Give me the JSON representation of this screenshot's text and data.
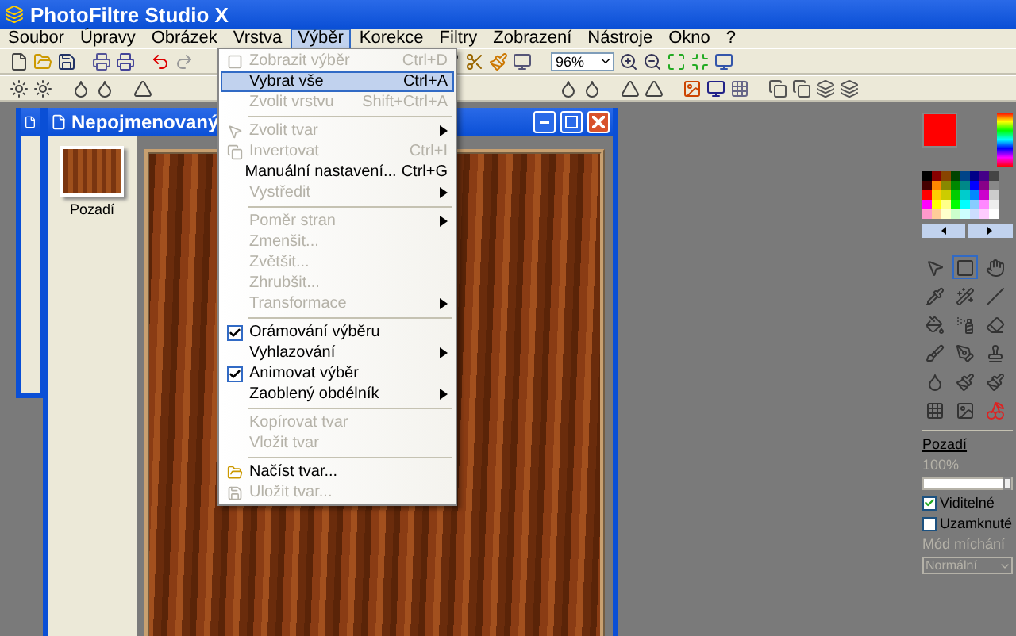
{
  "window": {
    "title": "PhotoFiltre Studio X"
  },
  "menu": [
    {
      "label": "Soubor",
      "selected": false
    },
    {
      "label": "Úpravy",
      "selected": false
    },
    {
      "label": "Obrázek",
      "selected": false
    },
    {
      "label": "Vrstva",
      "selected": false
    },
    {
      "label": "Výběr",
      "selected": true
    },
    {
      "label": "Korekce",
      "selected": false
    },
    {
      "label": "Filtry",
      "selected": false
    },
    {
      "label": "Zobrazení",
      "selected": false
    },
    {
      "label": "Nástroje",
      "selected": false
    },
    {
      "label": "Okno",
      "selected": false
    },
    {
      "label": "?",
      "selected": false
    }
  ],
  "zoom": {
    "value": "96%"
  },
  "document": {
    "title": "Nepojmenovaný",
    "layers": [
      {
        "name": "Pozadí"
      }
    ]
  },
  "dropdown": [
    {
      "kind": "item",
      "label": "Zobrazit výběr",
      "shortcut": "Ctrl+D",
      "disabled": true,
      "selected": false,
      "submenu": false
    },
    {
      "kind": "item",
      "label": "Vybrat vše",
      "shortcut": "Ctrl+A",
      "disabled": false,
      "selected": true,
      "submenu": false
    },
    {
      "kind": "item",
      "label": "Zvolit vrstvu",
      "shortcut": "Shift+Ctrl+A",
      "disabled": true,
      "selected": false,
      "submenu": false
    },
    {
      "kind": "separator"
    },
    {
      "kind": "item",
      "label": "Zvolit tvar",
      "disabled": true,
      "selected": false,
      "submenu": true
    },
    {
      "kind": "item",
      "label": "Invertovat",
      "shortcut": "Ctrl+I",
      "disabled": true,
      "selected": false,
      "submenu": false
    },
    {
      "kind": "item",
      "label": "Manuální nastavení...",
      "shortcut": "Ctrl+G",
      "disabled": false,
      "selected": false,
      "submenu": false
    },
    {
      "kind": "item",
      "label": "Vystředit",
      "disabled": true,
      "selected": false,
      "submenu": true
    },
    {
      "kind": "separator"
    },
    {
      "kind": "item",
      "label": "Poměr stran",
      "disabled": true,
      "selected": false,
      "submenu": true
    },
    {
      "kind": "item",
      "label": "Zmenšit...",
      "disabled": true,
      "selected": false,
      "submenu": false
    },
    {
      "kind": "item",
      "label": "Zvětšit...",
      "disabled": true,
      "selected": false,
      "submenu": false
    },
    {
      "kind": "item",
      "label": "Zhrubšit...",
      "disabled": true,
      "selected": false,
      "submenu": false
    },
    {
      "kind": "item",
      "label": "Transformace",
      "disabled": true,
      "selected": false,
      "submenu": true
    },
    {
      "kind": "separator"
    },
    {
      "kind": "check",
      "label": "Orámování výběru",
      "checked": true,
      "disabled": false,
      "selected": false,
      "submenu": false
    },
    {
      "kind": "item",
      "label": "Vyhlazování",
      "disabled": false,
      "selected": false,
      "submenu": true
    },
    {
      "kind": "check",
      "label": "Animovat výběr",
      "checked": true,
      "disabled": false,
      "selected": false,
      "submenu": false
    },
    {
      "kind": "item",
      "label": "Zaoblený obdélník",
      "disabled": false,
      "selected": false,
      "submenu": true
    },
    {
      "kind": "separator"
    },
    {
      "kind": "item",
      "label": "Kopírovat tvar",
      "disabled": true,
      "selected": false,
      "submenu": false
    },
    {
      "kind": "item",
      "label": "Vložit tvar",
      "disabled": true,
      "selected": false,
      "submenu": false
    },
    {
      "kind": "separator"
    },
    {
      "kind": "item",
      "label": "Načíst tvar...",
      "disabled": false,
      "selected": false,
      "submenu": false
    },
    {
      "kind": "item",
      "label": "Uložit tvar...",
      "disabled": true,
      "selected": false,
      "submenu": false
    }
  ],
  "layer_panel": {
    "name": "Pozadí",
    "opacity": "100%",
    "opacity_disabled": true,
    "opacity_slider": {
      "level": 1
    },
    "options": [
      {
        "label": "Viditelné",
        "checked": true
      },
      {
        "label": "Uzamknuté",
        "checked": false
      }
    ],
    "blend_label": "Mód míchání",
    "blend_value": "Normální",
    "blend_disabled": true
  }
}
